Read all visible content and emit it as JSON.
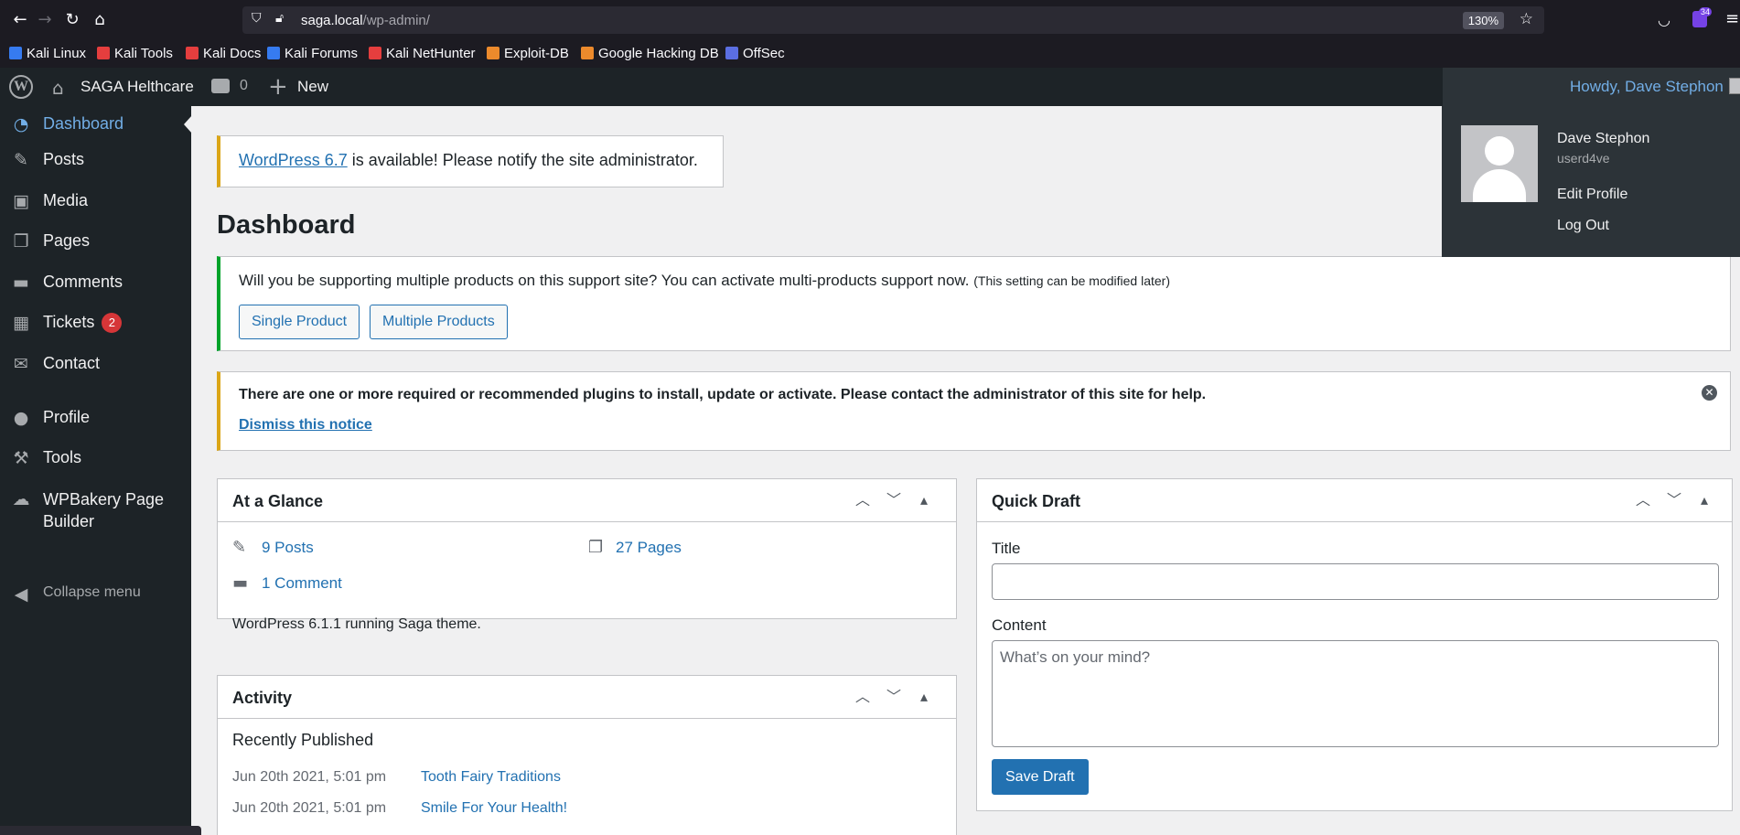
{
  "browser": {
    "url_host": "saga.local",
    "url_path": "/wp-admin/",
    "zoom": "130%",
    "extension_badge": "34",
    "bookmarks": [
      {
        "label": "Kali Linux",
        "color": "#367bf0"
      },
      {
        "label": "Kali Tools",
        "color": "#e53e3e"
      },
      {
        "label": "Kali Docs",
        "color": "#e53e3e"
      },
      {
        "label": "Kali Forums",
        "color": "#367bf0"
      },
      {
        "label": "Kali NetHunter",
        "color": "#e53e3e"
      },
      {
        "label": "Exploit-DB",
        "color": "#ec8a2c"
      },
      {
        "label": "Google Hacking DB",
        "color": "#ec8a2c"
      },
      {
        "label": "OffSec",
        "color": "#5b6ee1"
      }
    ]
  },
  "adminbar": {
    "site_name": "SAGA Helthcare",
    "comment_count": "0",
    "new_label": "New",
    "howdy": "Howdy, Dave Stephon"
  },
  "user_menu": {
    "display_name": "Dave Stephon",
    "username": "userd4ve",
    "edit_profile": "Edit Profile",
    "log_out": "Log Out"
  },
  "sidebar": {
    "items": [
      {
        "label": "Dashboard",
        "icon": "dashboard-icon"
      },
      {
        "label": "Posts",
        "icon": "pin-icon"
      },
      {
        "label": "Media",
        "icon": "media-icon"
      },
      {
        "label": "Pages",
        "icon": "pages-icon"
      },
      {
        "label": "Comments",
        "icon": "comment-icon"
      },
      {
        "label": "Tickets",
        "icon": "tickets-icon",
        "badge": "2"
      },
      {
        "label": "Contact",
        "icon": "mail-icon"
      },
      {
        "label": "Profile",
        "icon": "user-icon"
      },
      {
        "label": "Tools",
        "icon": "wrench-icon"
      },
      {
        "label": "WPBakery Page Builder",
        "icon": "cloud-icon"
      }
    ],
    "collapse_label": "Collapse menu"
  },
  "main": {
    "update_nag": {
      "link_text": "WordPress 6.7",
      "rest_text": " is available! Please notify the site administrator."
    },
    "title": "Dashboard",
    "products_notice": {
      "text": "Will you be supporting multiple products on this support site? You can activate multi-products support now.",
      "small": "(This setting can be modified later)",
      "single_label": "Single Product",
      "multiple_label": "Multiple Products"
    },
    "plugins_notice": {
      "text": "There are one or more required or recommended plugins to install, update or activate. Please contact the administrator of this site for help.",
      "dismiss": "Dismiss this notice"
    },
    "glance": {
      "title": "At a Glance",
      "posts": "9 Posts",
      "pages": "27 Pages",
      "comments": "1 Comment",
      "version_text": "WordPress 6.1.1 running Saga theme."
    },
    "activity": {
      "title": "Activity",
      "subtitle": "Recently Published",
      "items": [
        {
          "date": "Jun 20th 2021, 5:01 pm",
          "title": "Tooth Fairy Traditions"
        },
        {
          "date": "Jun 20th 2021, 5:01 pm",
          "title": "Smile For Your Health!"
        }
      ]
    },
    "quick_draft": {
      "title": "Quick Draft",
      "title_label": "Title",
      "title_value": "",
      "content_label": "Content",
      "content_placeholder": "What’s on your mind?",
      "save_label": "Save Draft"
    }
  },
  "colors": {
    "adminbar_bg": "#1d2327",
    "link": "#2271b1",
    "active_menu": "#72aee6",
    "badge": "#d63638",
    "notice_warning": "#dba617",
    "notice_success": "#00a32a"
  }
}
